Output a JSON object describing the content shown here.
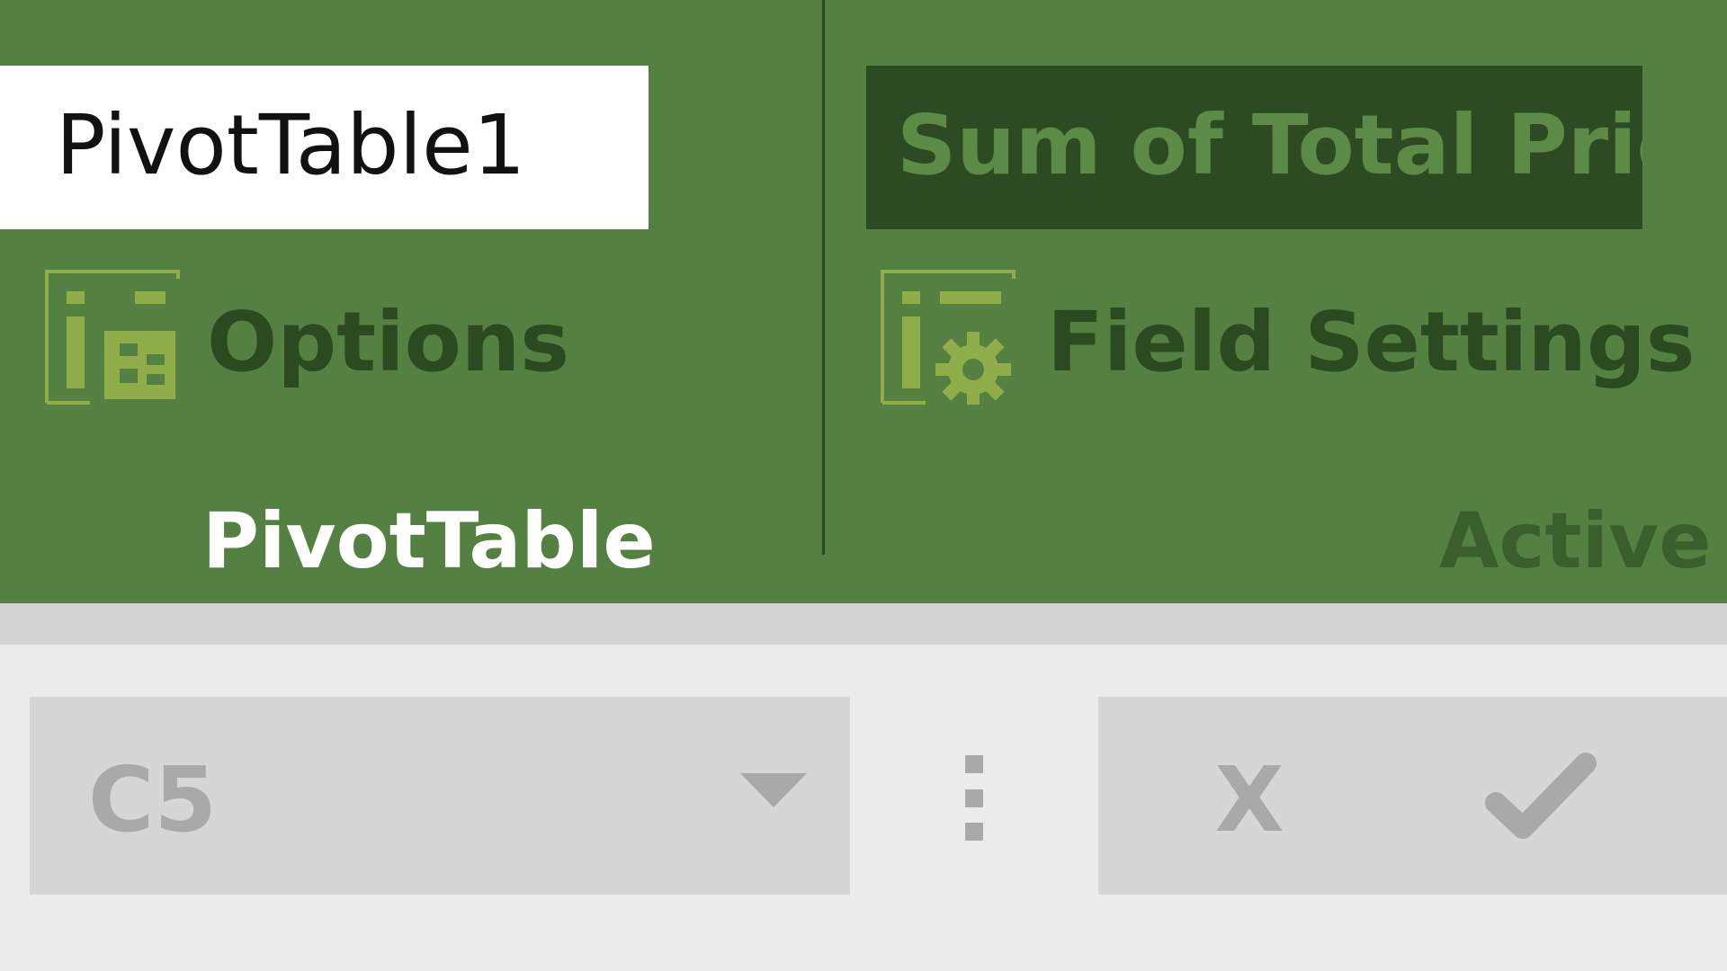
{
  "ribbon": {
    "name_box_value": "PivotTable1",
    "active_field_value": "Sum of Total Price",
    "options_label": "Options",
    "field_settings_label": "Field Settings",
    "group_pivottable_label": "PivotTable",
    "group_active_label": "Active",
    "icons": {
      "options": "pivot-options-icon",
      "field_settings": "field-settings-gear-icon"
    },
    "colors": {
      "ribbon_bg": "#548141",
      "dark_green": "#2c4a20",
      "icon_green": "#8fae4a"
    }
  },
  "formula_bar": {
    "name_box_value": "C5",
    "cancel_label": "X",
    "icons": {
      "dropdown": "chevron-down-icon",
      "more": "more-vertical-icon",
      "enter": "checkmark-icon"
    }
  }
}
